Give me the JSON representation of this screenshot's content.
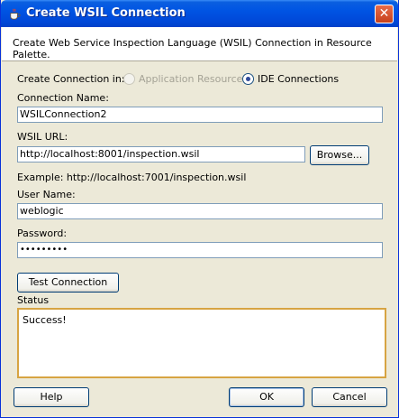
{
  "window": {
    "title": "Create WSIL Connection",
    "close_glyph": "✕"
  },
  "header": {
    "description": "Create Web Service Inspection Language (WSIL) Connection in Resource Palette."
  },
  "form": {
    "create_in_label": "Create Connection in:",
    "option_app_resources": "Application Resources",
    "option_ide_connections": "IDE Connections",
    "selected_option": "IDE Connections",
    "connection_name_label": "Connection Name:",
    "connection_name_value": "WSILConnection2",
    "wsil_url_label": "WSIL URL:",
    "wsil_url_value": "http://localhost:8001/inspection.wsil",
    "browse_label": "Browse...",
    "example_text": "Example: http://localhost:7001/inspection.wsil",
    "user_name_label": "User Name:",
    "user_name_value": "weblogic",
    "password_label": "Password:",
    "password_value": "•••••••••",
    "test_connection_label": "Test Connection",
    "status_label": "Status",
    "status_value": "Success!"
  },
  "footer": {
    "help_label": "Help",
    "ok_label": "OK",
    "cancel_label": "Cancel"
  },
  "colors": {
    "titlebar": "#0054e3",
    "dialog_bg": "#ece9d8",
    "status_border": "#d7a442"
  }
}
